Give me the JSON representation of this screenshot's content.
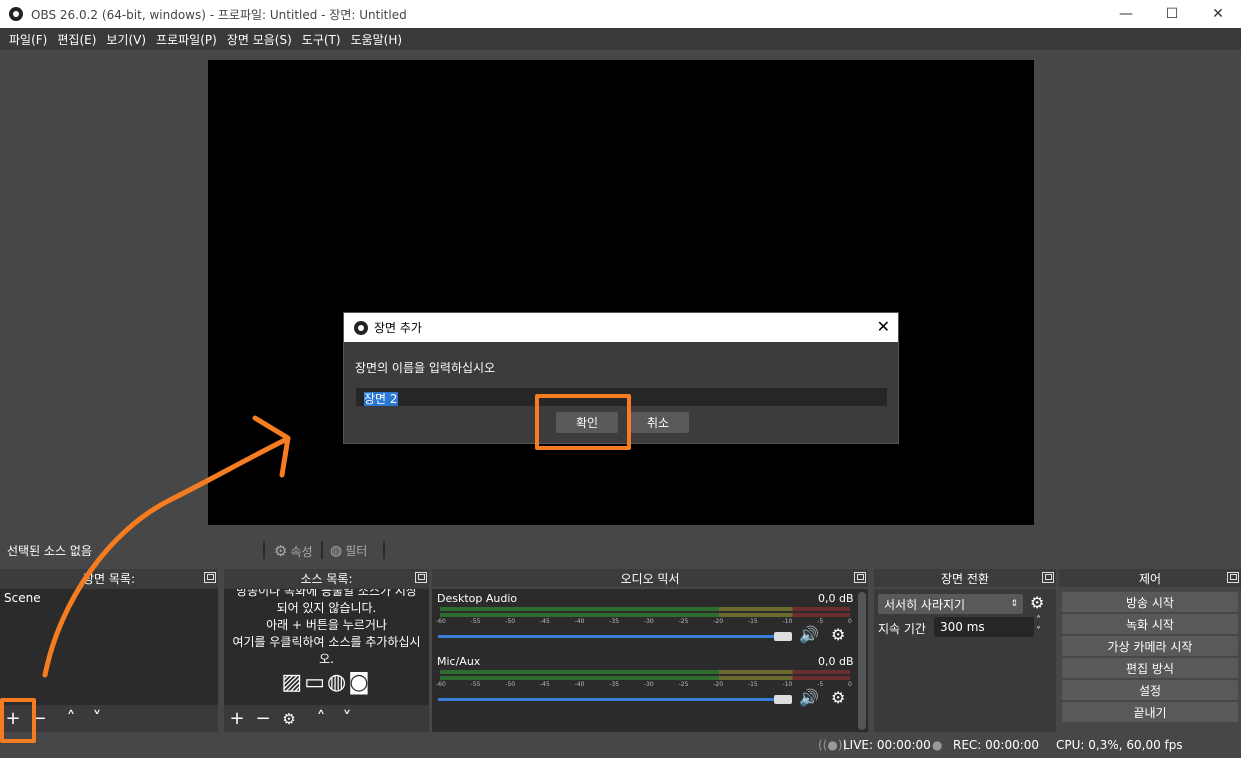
{
  "window": {
    "title": "OBS 26.0.2 (64-bit, windows) - 프로파일: Untitled - 장면: Untitled",
    "min": "—",
    "max": "☐",
    "close": "✕"
  },
  "menu": [
    "파일(F)",
    "편집(E)",
    "보기(V)",
    "프로파일(P)",
    "장면 모음(S)",
    "도구(T)",
    "도움말(H)"
  ],
  "dialog": {
    "title": "장면 추가",
    "close": "✕",
    "prompt": "장면의 이름을 입력하십시오",
    "input_value": "장면 2",
    "ok": "확인",
    "cancel": "취소"
  },
  "source_bar": {
    "no_source": "선택된 소스 없음",
    "properties": "속성",
    "filters": "필터"
  },
  "scenes": {
    "header": "장면 목록:",
    "items": [
      "Scene"
    ]
  },
  "sources": {
    "header": "소스 목록:",
    "empty_text": [
      "방송이나 녹화에 등불일 소스가 시상",
      "되어 있지 않습니다.",
      "아래 + 버튼을 누르거나",
      "여기를 우클릭하여 소스를 추가하십시",
      "오."
    ]
  },
  "mixer": {
    "header": "오디오 믹서",
    "channels": [
      {
        "name": "Desktop Audio",
        "db": "0,0 dB"
      },
      {
        "name": "Mic/Aux",
        "db": "0,0 dB"
      }
    ],
    "ticks": [
      "-60",
      "-55",
      "-50",
      "-45",
      "-40",
      "-35",
      "-30",
      "-25",
      "-20",
      "-15",
      "-10",
      "-5",
      "0"
    ]
  },
  "transitions": {
    "header": "장면 전환",
    "selected": "서서히 사라지기",
    "duration_label": "지속 기간",
    "duration": "300 ms"
  },
  "controls": {
    "header": "제어",
    "buttons": [
      "방송 시작",
      "녹화 시작",
      "가상 카메라 시작",
      "편집 방식",
      "설정",
      "끝내기"
    ]
  },
  "status": {
    "live": "LIVE: 00:00:00",
    "rec": "REC: 00:00:00",
    "cpu": "CPU: 0,3%, 60,00 fps"
  },
  "colors": {
    "highlight": "#f57c20",
    "selection": "#2a78d4"
  }
}
